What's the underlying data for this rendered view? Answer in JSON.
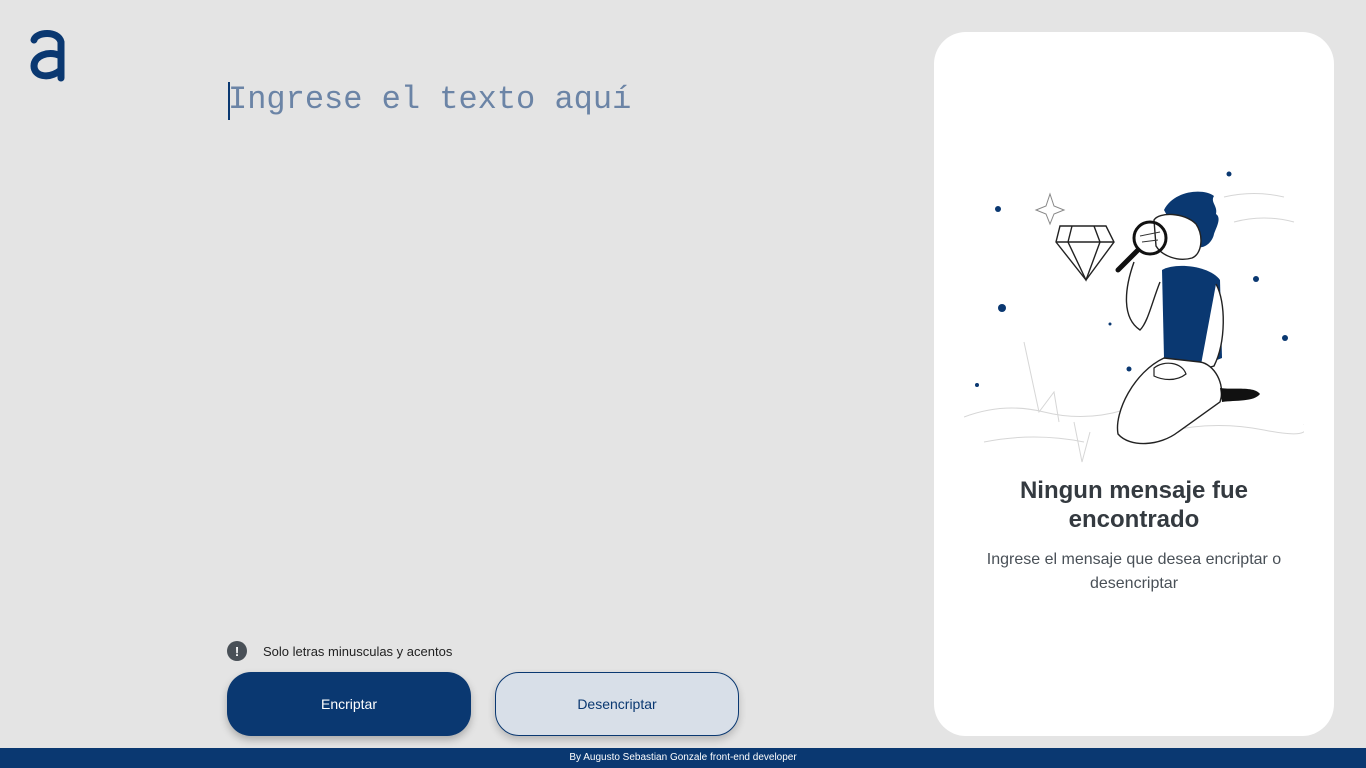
{
  "app": {
    "logo_letter": "a",
    "accent": "#0a3871",
    "background": "#e4e4e4"
  },
  "input": {
    "placeholder": "Ingrese el texto aquí",
    "value": ""
  },
  "hint": {
    "icon": "exclamation-icon",
    "text": "Solo letras minusculas y acentos"
  },
  "buttons": {
    "encrypt_label": "Encriptar",
    "decrypt_label": "Desencriptar"
  },
  "panel": {
    "illustration": "person-with-magnifier-illustration",
    "title": "Ningun mensaje fue encontrado",
    "subtitle": "Ingrese el mensaje que desea encriptar o desencriptar"
  },
  "footer": {
    "text": "By Augusto Sebastian Gonzale front-end developer"
  }
}
